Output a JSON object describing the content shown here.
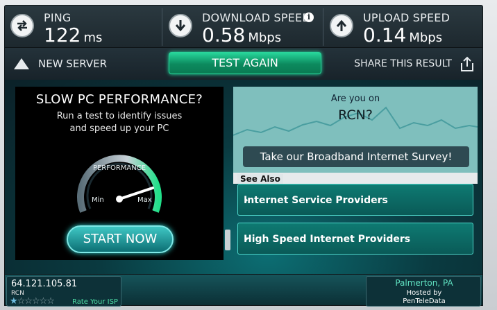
{
  "stats": {
    "ping": {
      "label": "PING",
      "value": "122",
      "unit": "ms"
    },
    "download": {
      "label": "DOWNLOAD SPEED",
      "value": "0.58",
      "unit": "Mbps"
    },
    "upload": {
      "label": "UPLOAD SPEED",
      "value": "0.14",
      "unit": "Mbps"
    }
  },
  "actions": {
    "new_server": "NEW SERVER",
    "test_again": "TEST AGAIN",
    "share": "SHARE THIS RESULT"
  },
  "ad_left": {
    "headline": "SLOW PC PERFORMANCE?",
    "sub_line1": "Run a test to identify issues",
    "sub_line2": "and speed up your PC",
    "gauge_label": "PERFORMANCE",
    "gauge_min": "Min",
    "gauge_max": "Max",
    "button": "START NOW"
  },
  "ad_right": {
    "question1": "Are you on",
    "question2": "RCN?",
    "survey": "Take our Broadband Internet Survey!"
  },
  "see_also": {
    "label": "See Also",
    "links": [
      "Internet Service Providers",
      "High Speed Internet Providers"
    ]
  },
  "bottom": {
    "ip": "64.121.105.81",
    "isp": "RCN",
    "rate": "Rate Your ISP",
    "location": "Palmerton, PA",
    "hosted_by": "Hosted by",
    "host": "PenTeleData"
  },
  "colors": {
    "accent_green": "#0c8a5e",
    "teal": "#0d6f74",
    "bar_dark": "#1d282e"
  }
}
